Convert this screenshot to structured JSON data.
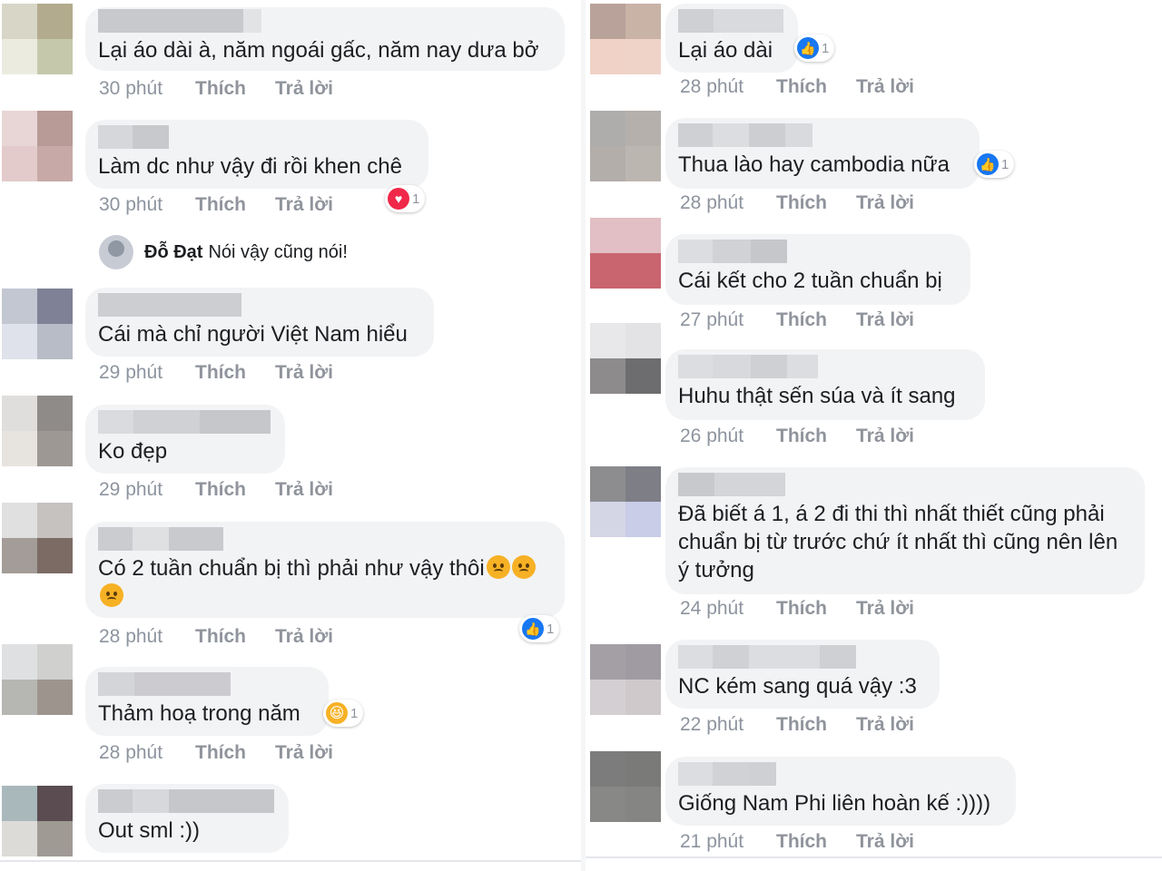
{
  "left_comments": [
    {
      "text": "Lại áo dài à, năm ngoái gấc, năm nay dưa bở",
      "time": "30 phút",
      "like": "Thích",
      "reply": "Trả lời"
    },
    {
      "text": "Làm dc như vậy đi rồi khen chê",
      "time": "30 phút",
      "like": "Thích",
      "reply": "Trả lời",
      "reaction_count": "1"
    },
    {
      "text": "Cái mà chỉ người Việt Nam hiểu",
      "time": "29 phút",
      "like": "Thích",
      "reply": "Trả lời"
    },
    {
      "text": "Ko đẹp",
      "time": "29 phút",
      "like": "Thích",
      "reply": "Trả lời"
    },
    {
      "text": "Có 2 tuần chuẩn bị thì phải như vậy thôi",
      "time": "28 phút",
      "like": "Thích",
      "reply": "Trả lời",
      "reaction_count": "1"
    },
    {
      "text": "Thảm hoạ trong năm",
      "time": "28 phút",
      "like": "Thích",
      "reply": "Trả lời",
      "reaction_count": "1"
    },
    {
      "text": "Out sml :))"
    }
  ],
  "sub_reply": {
    "name": "Đỗ Đạt",
    "text": "Nói vậy cũng nói!"
  },
  "right_comments": [
    {
      "text": "Lại áo dài",
      "time": "28 phút",
      "like": "Thích",
      "reply": "Trả lời",
      "reaction_count": "1"
    },
    {
      "text": "Thua lào hay cambodia nữa",
      "time": "28 phút",
      "like": "Thích",
      "reply": "Trả lời",
      "reaction_count": "1"
    },
    {
      "text": "Cái kết cho 2 tuần chuẩn bị",
      "time": "27 phút",
      "like": "Thích",
      "reply": "Trả lời"
    },
    {
      "text": "Huhu thật sến súa và ít sang",
      "time": "26 phút",
      "like": "Thích",
      "reply": "Trả lời"
    },
    {
      "text": "Đã biết á 1, á 2 đi thi thì nhất thiết cũng phải chuẩn bị từ trước chứ ít nhất thì cũng nên lên ý tưởng",
      "time": "24 phút",
      "like": "Thích",
      "reply": "Trả lời"
    },
    {
      "text": "NC kém sang quá vậy :3",
      "time": "22 phút",
      "like": "Thích",
      "reply": "Trả lời"
    },
    {
      "text": "Giống Nam Phi liên hoàn kế :))))",
      "time": "21 phút",
      "like": "Thích",
      "reply": "Trả lời"
    }
  ],
  "reaction_icons": {
    "like": "like-icon",
    "love": "heart-icon",
    "haha": "haha-icon",
    "sad": "sad-emoji-icon"
  },
  "colors": {
    "bubble": "#f2f3f5",
    "meta": "#8d949e",
    "like_blue": "#1877f2",
    "love_red": "#f02849",
    "haha_yellow": "#f7b125"
  }
}
